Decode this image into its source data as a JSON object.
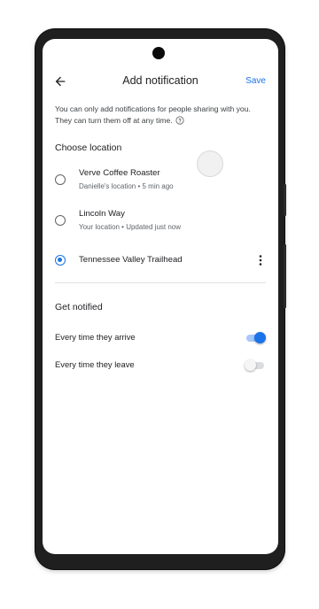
{
  "appbar": {
    "title": "Add notification",
    "save_label": "Save",
    "back_icon": "arrow-back-icon"
  },
  "info": {
    "text": "You can only add notifications for people sharing with you. They can turn them off at any time.",
    "help_icon": "help-circle-icon"
  },
  "choose_location": {
    "title": "Choose location",
    "options": [
      {
        "name": "Verve Coffee Roaster",
        "subtitle": "Danielle's location • 5 min ago",
        "selected": false
      },
      {
        "name": "Lincoln Way",
        "subtitle": "Your location • Updated just now",
        "selected": false
      },
      {
        "name": "Tennessee Valley Trailhead",
        "subtitle": "",
        "selected": true,
        "more_icon": "more-vert-icon"
      }
    ]
  },
  "get_notified": {
    "title": "Get notified",
    "options": [
      {
        "label": "Every time they arrive",
        "enabled": true
      },
      {
        "label": "Every time they leave",
        "enabled": false
      }
    ]
  },
  "colors": {
    "accent": "#1a73e8",
    "text_primary": "#202124",
    "text_secondary": "#5f6368"
  }
}
